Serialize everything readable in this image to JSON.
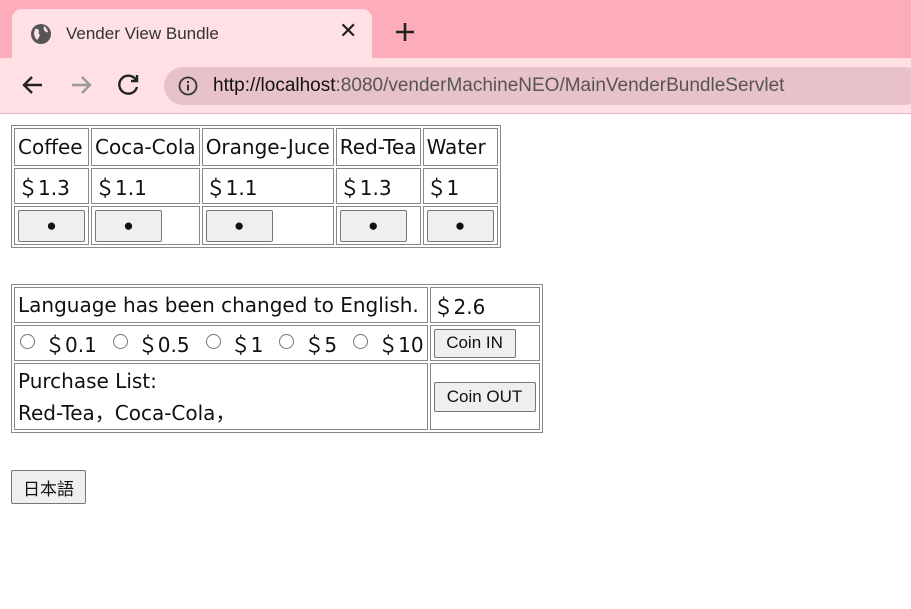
{
  "browser": {
    "tab_title": "Vender View Bundle",
    "url_host": "http://localhost",
    "url_rest": ":8080/venderMachineNEO/MainVenderBundleServlet"
  },
  "products": {
    "names": [
      "Coffee",
      "Coca-Cola",
      "Orange-Juce",
      "Red-Tea",
      "Water"
    ],
    "prices": [
      "＄1.3",
      "＄1.1",
      "＄1.1",
      "＄1.3",
      "＄1"
    ],
    "button_label": "●"
  },
  "panel": {
    "message": "Language has been changed to English.",
    "balance": "＄2.6",
    "coins": [
      "＄0.1",
      "＄0.5",
      "＄1",
      "＄5",
      "＄10"
    ],
    "coin_in_label": "Coin IN",
    "purchase_list_title": "Purchase List:",
    "purchase_list_items": "Red-Tea，Coca-Cola，",
    "coin_out_label": "Coin OUT"
  },
  "language_button_label": "日本語"
}
